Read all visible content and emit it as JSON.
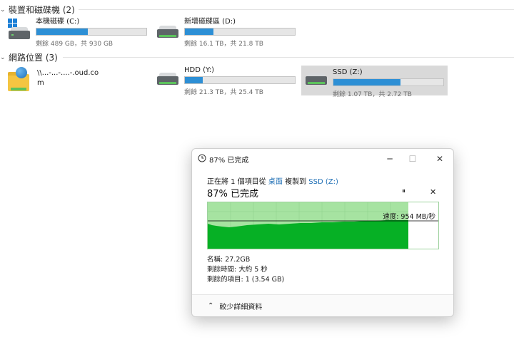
{
  "devices_group": {
    "label": "裝置和磁碟機 (2)"
  },
  "network_group": {
    "label": "網路位置 (3)"
  },
  "drives": [
    {
      "name": "本機磁碟 (C:)",
      "free": "剩餘 489 GB，共 930 GB",
      "used_fraction": 0.47
    },
    {
      "name": "新增磁碟區 (D:)",
      "free": "剩餘 16.1 TB，共 21.8 TB",
      "used_fraction": 0.26
    },
    {
      "name": "HDD (Y:)",
      "free": "剩餘 21.3 TB，共 25.4 TB",
      "used_fraction": 0.16
    },
    {
      "name": "SSD (Z:)",
      "free": "剩餘 1.07 TB，共 2.72 TB",
      "used_fraction": 0.61
    }
  ],
  "network_location": {
    "line1": "\\\\...-...-....-.oud.co",
    "line2": "m"
  },
  "dialog": {
    "title": "87% 已完成",
    "copy_prefix": "正在將 1 個項目從",
    "copy_source": "桌面",
    "copy_mid": "複製到",
    "copy_dest": "SSD (Z:)",
    "percent_text": "87% 已完成",
    "pause_glyph": "⏸",
    "cancel_glyph": "✕",
    "speed_text": "速度: 954 MB/秒",
    "name_line": "名稱: 27.2GB",
    "time_line": "剩餘時間: 大約 5 秒",
    "items_line": "剩餘的項目: 1 (3.54 GB)",
    "less_details": "較少詳細資料",
    "progress_fraction": 0.87
  },
  "colors": {
    "accent": "#2d8fd5",
    "progress_light": "#a6e3a1",
    "progress_dark": "#06b025",
    "link": "#1f6fb5"
  }
}
